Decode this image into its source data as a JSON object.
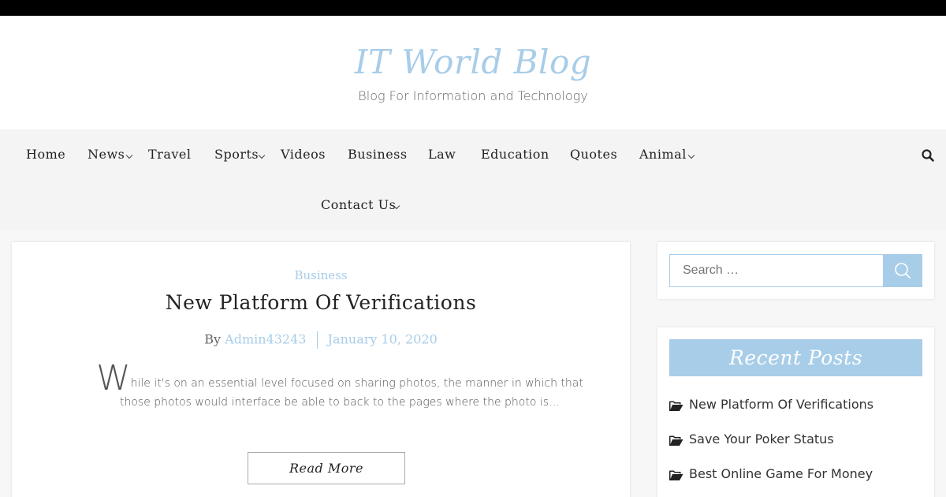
{
  "site": {
    "title": "IT World Blog",
    "tagline": "Blog For Information and Technology"
  },
  "nav": {
    "items": [
      {
        "label": "Home",
        "has_submenu": false
      },
      {
        "label": "News",
        "has_submenu": true
      },
      {
        "label": "Travel",
        "has_submenu": false
      },
      {
        "label": "Sports",
        "has_submenu": true
      },
      {
        "label": "Videos",
        "has_submenu": false
      },
      {
        "label": "Business",
        "has_submenu": false
      },
      {
        "label": "Law",
        "has_submenu": false
      },
      {
        "label": "Education",
        "has_submenu": false
      },
      {
        "label": "Quotes",
        "has_submenu": false
      },
      {
        "label": "Animal",
        "has_submenu": true
      },
      {
        "label": "Contact Us",
        "has_submenu": true
      }
    ],
    "search_icon": "search-icon"
  },
  "post": {
    "category": "Business",
    "title": "New Platform Of Verifications",
    "by_label": "By",
    "author": "Admin43243",
    "date": "January 10, 2020",
    "dropcap": "W",
    "excerpt": "hile it's on an essential level focused on sharing photos, the manner in which that those photos would interface be able to back to the pages where the photo is…",
    "read_more_label": "Read More"
  },
  "sidebar": {
    "search": {
      "placeholder": "Search …",
      "button_icon": "search-icon"
    },
    "recent_posts": {
      "title": "Recent Posts",
      "items": [
        "New Platform Of Verifications",
        "Save Your Poker Status",
        "Best Online Game For Money"
      ],
      "item_icon": "folder-open-icon"
    }
  },
  "colors": {
    "accent": "#a8cde8",
    "topbar": "#000000",
    "nav_background": "#f4f4f4",
    "page_background": "#f7f7f7"
  }
}
